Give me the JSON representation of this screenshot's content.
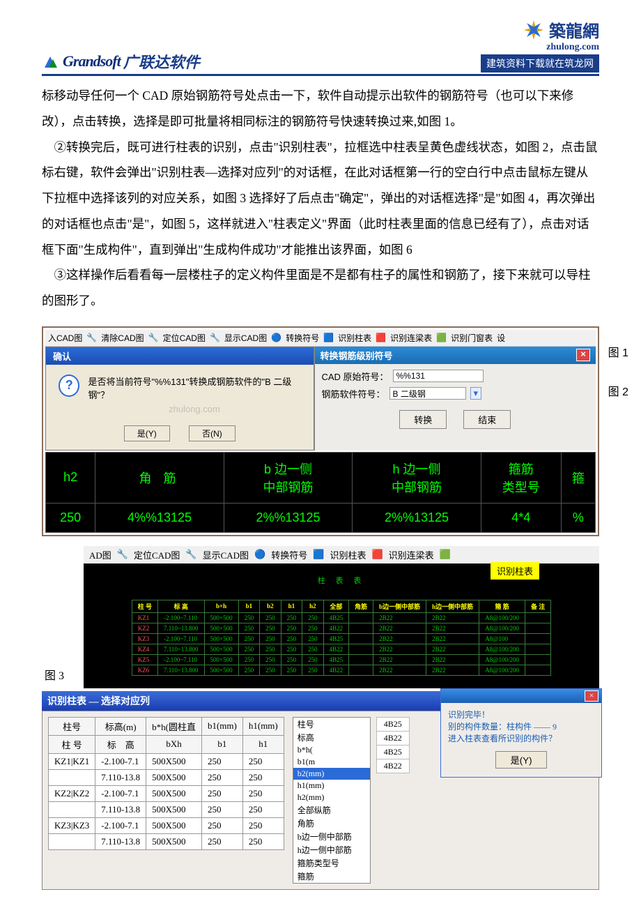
{
  "header": {
    "brand1_script": "Grandsoft",
    "brand1_cn": "广联达软件",
    "brand2_cn": "築龍網",
    "brand2_dom": "zhulong.com",
    "brand2_slogan": "建筑资料下载就在筑龙网"
  },
  "para": {
    "p1": "标移动导任何一个 CAD 原始钢筋符号处点击一下，软件自动提示出软件的钢筋符号（也可以下来修改），点击转换，选择是即可批量将相同标注的钢筋符号快速转换过来,如图 1。",
    "p2": "　②转换完后，既可进行柱表的识别，点击\"识别柱表\"，拉框选中柱表呈黄色虚线状态，如图 2，点击鼠标右键，软件会弹出\"识别柱表—选择对应列\"的对话框，在此对话框第一行的空白行中点击鼠标左键从下拉框中选择该列的对应关系，如图 3 选择好了后点击\"确定\"，弹出的对话框选择\"是\"如图 4，再次弹出的对话框也点击\"是\"，如图 5，这样就进入\"柱表定义\"界面（此时柱表里面的信息已经有了），点击对话框下面\"生成构件\"，直到弹出\"生成构件成功\"才能推出该界面，如图 6",
    "p3": "　③这样操作后看看每一层楼柱子的定义构件里面是不是都有柱子的属性和钢筋了，接下来就可以导柱的图形了。"
  },
  "toolbar1": {
    "a": "入CAD图",
    "b": "清除CAD图",
    "c": "定位CAD图",
    "d": "显示CAD图",
    "e": "转换符号",
    "f": "识别柱表",
    "g": "识别连梁表",
    "h": "识别门窗表",
    "i": "设"
  },
  "confirm": {
    "title": "确认",
    "msg": "是否将当前符号\"%%131\"转换成钢筋软件的\"B 二级钢\"？",
    "wm": "zhulong.com",
    "yes": "是(Y)",
    "no": "否(N)"
  },
  "convpanel": {
    "title": "转换钢筋级别符号",
    "l1": "CAD 原始符号：",
    "v1": "%%131",
    "l2": "钢筋软件符号：",
    "v2": "B 二级钢",
    "b1": "转换",
    "b2": "结束"
  },
  "figlabels": {
    "f1": "图 1",
    "f2": "图 2",
    "f3": "图 3"
  },
  "green": {
    "h": [
      "h2",
      "角 筋",
      "b 边一侧\n中部钢筋",
      "h 边一侧\n中部钢筋",
      "箍筋\n类型号",
      "箍"
    ],
    "r": [
      "250",
      "4%%13125",
      "2%%13125",
      "2%%13125",
      "4*4",
      "%"
    ]
  },
  "toolbar2": {
    "a": "AD图",
    "b": "定位CAD图",
    "c": "显示CAD图",
    "d": "转换符号",
    "e": "识别柱表",
    "f": "识别连梁表"
  },
  "tag3": "识别柱表",
  "tiny": {
    "title": "柱 表 表",
    "head": [
      "柱 号",
      "标  高",
      "b×h",
      "b1",
      "b2",
      "h1",
      "h2",
      "全部",
      "角筋",
      "b边一侧中部筋",
      "h边一侧中部筋",
      "箍  筋",
      "备  注"
    ],
    "rows": [
      [
        "KZ1",
        "-2.100~7.110",
        "500×500",
        "250",
        "250",
        "250",
        "250",
        "4B25",
        "",
        "2B22",
        "2B22",
        "A8@100/200",
        ""
      ],
      [
        "KZ2",
        "7.110~13.800",
        "500×500",
        "250",
        "250",
        "250",
        "250",
        "4B22",
        "",
        "2B22",
        "2B22",
        "A8@100/200",
        ""
      ],
      [
        "KZ3",
        "-2.100~7.110",
        "500×500",
        "250",
        "250",
        "250",
        "250",
        "4B25",
        "",
        "2B22",
        "2B22",
        "A8@100",
        ""
      ],
      [
        "KZ4",
        "7.110~13.800",
        "500×500",
        "250",
        "250",
        "250",
        "250",
        "4B22",
        "",
        "2B22",
        "2B22",
        "A8@100/200",
        ""
      ],
      [
        "KZ5",
        "-2.100~7.110",
        "500×500",
        "250",
        "250",
        "250",
        "250",
        "4B25",
        "",
        "2B22",
        "2B22",
        "A8@100/200",
        ""
      ],
      [
        "KZ6",
        "7.110~13.800",
        "500×500",
        "250",
        "250",
        "250",
        "250",
        "4B22",
        "",
        "2B22",
        "2B22",
        "A8@100/200",
        ""
      ]
    ]
  },
  "map": {
    "title": "识别柱表 — 选择对应列",
    "head": [
      "柱号",
      "标高(m)",
      "b*h(圆柱直",
      "b1(mm)",
      "h1(mm)"
    ],
    "sub": [
      "柱 号",
      "标　高",
      "bXh",
      "b1",
      "h1"
    ],
    "rows": [
      [
        "KZ1|KZ1",
        "-2.100-7.1",
        "500X500",
        "250",
        "250"
      ],
      [
        "",
        "7.110-13.8",
        "500X500",
        "250",
        "250"
      ],
      [
        "KZ2|KZ2",
        "-2.100-7.1",
        "500X500",
        "250",
        "250"
      ],
      [
        "",
        "7.110-13.8",
        "500X500",
        "250",
        "250"
      ],
      [
        "KZ3|KZ3",
        "-2.100-7.1",
        "500X500",
        "250",
        "250"
      ],
      [
        "",
        "7.110-13.8",
        "500X500",
        "250",
        "250"
      ]
    ]
  },
  "drop": [
    "柱号",
    "标高",
    "b*h(",
    "b1(m",
    "b2(mm)",
    "h1(mm)",
    "h2(mm)",
    "全部纵筋",
    "角筋",
    "b边一侧中部筋",
    "h边一侧中部筋",
    "箍筋类型号",
    "箍筋"
  ],
  "dropsel": 4,
  "side": {
    "l1": "识别完毕！",
    "l2": "别的构件数量：柱构件 —— 9",
    "l3": "进入柱表查看所识别的构件？",
    "btn": "是(Y)"
  },
  "extra": [
    "4B25",
    "4B22",
    "4B25",
    "4B22"
  ]
}
